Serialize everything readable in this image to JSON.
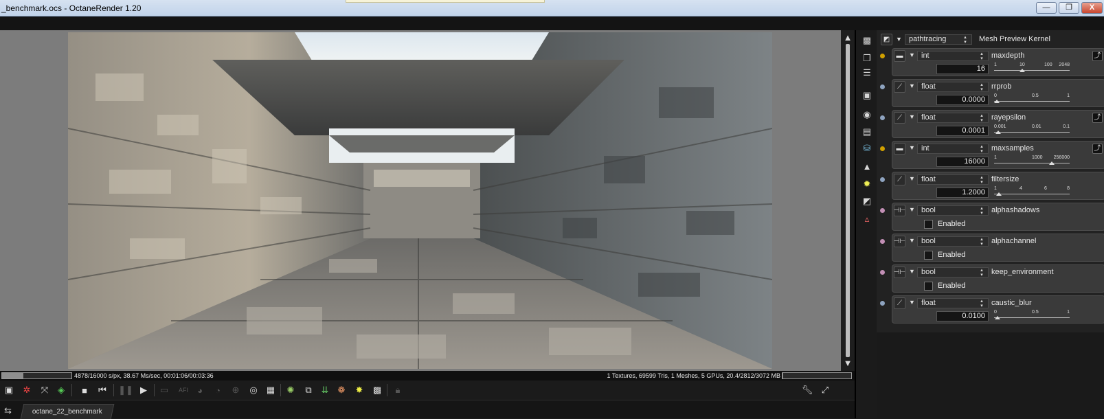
{
  "window": {
    "title": "_benchmark.ocs - OctaneRender 1.20",
    "buttons": {
      "minimize": "—",
      "maximize": "❐",
      "close": "X"
    }
  },
  "render": {
    "description": "rendered benchmark scene (stone corridor)"
  },
  "status": {
    "left": "4878/16000 s/px, 38.67 Ms/sec, 00:01:06/00:03:36",
    "right": "1 Textures, 69599 Tris, 1 Meshes, 5 GPUs, 20.4/2812/3072 MB",
    "progress_fraction": 0.305,
    "memory_fraction": 0.01
  },
  "toolbar": {
    "icons": [
      "save-image-icon",
      "film-icon",
      "transform-icon",
      "cube-icon",
      "stop-icon",
      "restart-icon",
      "pause-icon",
      "play-icon",
      "monitor-icon",
      "afi-icon",
      "color-icon",
      "dof-icon",
      "focus-icon",
      "camera-icon",
      "region-icon",
      "pick-icon",
      "copy-icon",
      "import-icon",
      "material-icon",
      "light-icon",
      "render-target-icon",
      "lock-icon",
      "wrench-icon",
      "fullscreen-icon"
    ]
  },
  "tabs": [
    {
      "label": "octane_22_benchmark"
    }
  ],
  "panel": {
    "kernel": {
      "type": "pathtracing",
      "label": "Mesh Preview Kernel"
    },
    "params": [
      {
        "name": "maxdepth",
        "type": "int",
        "value": "16",
        "kind": "slider",
        "ticks": [
          "1",
          "10",
          "100",
          "2048"
        ],
        "level": 0.36,
        "dot": "#d0a000",
        "curve": true
      },
      {
        "name": "rrprob",
        "type": "float",
        "value": "0.0000",
        "kind": "slider",
        "ticks": [
          "0",
          "0.5",
          "1"
        ],
        "level": 0.0,
        "dot": "#8ea3bf",
        "curve": false
      },
      {
        "name": "rayepsilon",
        "type": "float",
        "value": "0.0001",
        "kind": "slider",
        "ticks": [
          "0.001",
          "0.01",
          "0.1"
        ],
        "level": 0.02,
        "dot": "#8ea3bf",
        "curve": true
      },
      {
        "name": "maxsamples",
        "type": "int",
        "value": "16000",
        "kind": "slider",
        "ticks": [
          "1",
          "1000",
          "256000"
        ],
        "level": 0.77,
        "dot": "#d0a000",
        "curve": true
      },
      {
        "name": "filtersize",
        "type": "float",
        "value": "1.2000",
        "kind": "slider",
        "ticks": [
          "1",
          "4",
          "6",
          "8"
        ],
        "level": 0.03,
        "dot": "#8ea3bf",
        "curve": false
      },
      {
        "name": "alphashadows",
        "type": "bool",
        "value": "Enabled",
        "kind": "check",
        "dot": "#c28fb5"
      },
      {
        "name": "alphachannel",
        "type": "bool",
        "value": "Enabled",
        "kind": "check",
        "dot": "#c28fb5"
      },
      {
        "name": "keep_environment",
        "type": "bool",
        "value": "Enabled",
        "kind": "check",
        "dot": "#c28fb5"
      },
      {
        "name": "caustic_blur",
        "type": "float",
        "value": "0.0100",
        "kind": "slider",
        "ticks": [
          "0",
          "0.5",
          "1"
        ],
        "level": 0.01,
        "dot": "#8ea3bf",
        "curve": false
      }
    ],
    "side_icons": [
      "render-target-icon",
      "layers-icon",
      "list-icon",
      "image-icon",
      "camera-icon",
      "film-icon",
      "mesh-icon",
      "environment-icon",
      "sun-icon",
      "kernel-icon",
      "material-icon"
    ]
  }
}
